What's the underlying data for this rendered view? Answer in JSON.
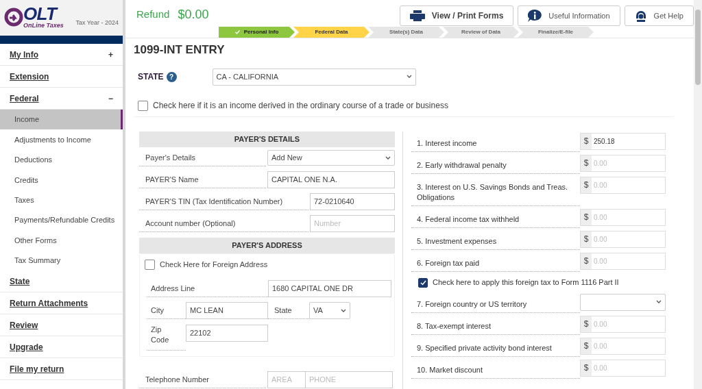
{
  "brand": {
    "logo": "OLT",
    "tagline": "OnLine Taxes",
    "tax_year": "Tax Year - 2024"
  },
  "refund": {
    "label": "Refund",
    "amount": "$0.00"
  },
  "header_buttons": [
    {
      "label": "View / Print Forms"
    },
    {
      "label": "Useful Information"
    },
    {
      "label": "Get Help"
    }
  ],
  "steps": [
    {
      "label": "Personal Info",
      "kind": "done"
    },
    {
      "label": "Federal Data",
      "kind": "current"
    },
    {
      "label": "State(s) Data",
      "kind": "pending"
    },
    {
      "label": "Review of Data",
      "kind": "pending"
    },
    {
      "label": "Finalize/E-file",
      "kind": "pending"
    }
  ],
  "sidebar": {
    "items": [
      {
        "label": "My Info",
        "toggle": "+"
      },
      {
        "label": "Extension"
      },
      {
        "label": "Federal",
        "toggle": "−",
        "children": [
          {
            "label": "Income",
            "selected": true
          },
          {
            "label": "Adjustments to Income",
            "selected": false
          },
          {
            "label": "Deductions",
            "selected": false
          },
          {
            "label": "Credits",
            "selected": false
          },
          {
            "label": "Taxes",
            "selected": false
          },
          {
            "label": "Payments/Refundable Credits",
            "selected": false
          },
          {
            "label": "Other Forms",
            "selected": false
          },
          {
            "label": "Tax Summary",
            "selected": false
          }
        ]
      },
      {
        "label": "State"
      },
      {
        "label": "Return Attachments"
      },
      {
        "label": "Review"
      },
      {
        "label": "Upgrade"
      },
      {
        "label": "File my return"
      }
    ]
  },
  "form": {
    "title": "1099-INT ENTRY",
    "state": {
      "label": "STATE",
      "help": "?",
      "value": "CA - CALIFORNIA"
    },
    "trade_business": {
      "label": "Check here if it is an income derived in the ordinary course of a trade or business",
      "checked": false
    },
    "payer_details": {
      "title": "PAYER'S DETAILS",
      "rows": [
        {
          "label": "Payer's Details",
          "kind": "select",
          "value": "Add New"
        },
        {
          "label": "PAYER'S Name",
          "kind": "text",
          "value": "CAPITAL ONE N.A."
        },
        {
          "label": "PAYER'S TIN (Tax Identification Number)",
          "kind": "text",
          "value": "72-0210640"
        },
        {
          "label": "Account number (Optional)",
          "kind": "text",
          "placeholder": "Number"
        }
      ]
    },
    "payer_address": {
      "title": "PAYER'S ADDRESS",
      "foreign": {
        "label": "Check Here for Foreign Address",
        "checked": false
      },
      "address_line": {
        "label": "Address Line",
        "value": "1680 CAPITAL ONE DR"
      },
      "city": {
        "label": "City",
        "value": "MC LEAN"
      },
      "state": {
        "label": "State",
        "value": "VA"
      },
      "zip": {
        "label": "Zip Code",
        "value": "22102"
      }
    },
    "telephone": {
      "label": "Telephone Number",
      "area_placeholder": "AREA",
      "phone_placeholder": "PHONE"
    },
    "amounts": [
      {
        "kind": "money",
        "label": "1. Interest income",
        "currency": "$",
        "value": "250.18"
      },
      {
        "kind": "money",
        "label": "2. Early withdrawal penalty",
        "currency": "$",
        "placeholder": "0.00"
      },
      {
        "kind": "money",
        "label": "3. Interest on U.S. Savings Bonds and Treas. Obligations",
        "currency": "$",
        "placeholder": "0.00"
      },
      {
        "kind": "money",
        "label": "4. Federal income tax withheld",
        "currency": "$",
        "placeholder": "0.00"
      },
      {
        "kind": "money",
        "label": "5. Investment expenses",
        "currency": "$",
        "placeholder": "0.00"
      },
      {
        "kind": "money",
        "label": "6. Foreign tax paid",
        "currency": "$",
        "placeholder": "0.00"
      },
      {
        "kind": "checkbox",
        "label": "Check here to apply this foreign tax to Form 1116 Part II",
        "checked": true
      },
      {
        "kind": "select",
        "label": "7. Foreign country or US territory"
      },
      {
        "kind": "money",
        "label": "8. Tax-exempt interest",
        "currency": "$",
        "placeholder": "0.00"
      },
      {
        "kind": "money",
        "label": "9. Specified private activity bond interest",
        "currency": "$",
        "placeholder": "0.00"
      },
      {
        "kind": "money",
        "label": "10. Market discount",
        "currency": "$",
        "placeholder": "0.00"
      }
    ]
  }
}
